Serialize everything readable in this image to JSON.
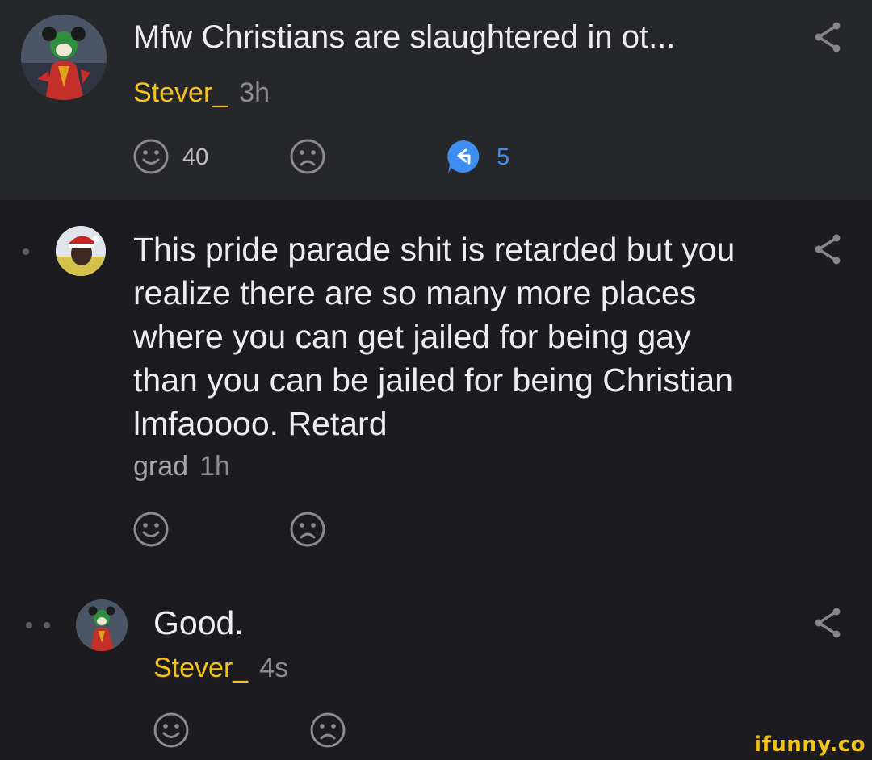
{
  "post": {
    "title": "Mfw Christians are slaughtered in ot...",
    "username": "Stever_",
    "time": "3h",
    "smile_count": "40",
    "reply_count": "5"
  },
  "comments": [
    {
      "text": "This pride parade shit is retarded but you realize there are so many more places where you can get jailed for being gay than you can be jailed for being Christian lmfaoooo. Retard",
      "username": "grad",
      "time": "1h"
    },
    {
      "text": "Good.",
      "username": "Stever_",
      "time": "4s"
    }
  ],
  "watermark": "ifunny.co",
  "icons": [
    "smile-icon",
    "frown-icon",
    "reply-icon",
    "share-icon"
  ],
  "colors": {
    "username": "#f3c21b",
    "reply_accent": "#3d8ef0",
    "header_bg": "#26272b",
    "page_bg": "#1c1c20"
  }
}
